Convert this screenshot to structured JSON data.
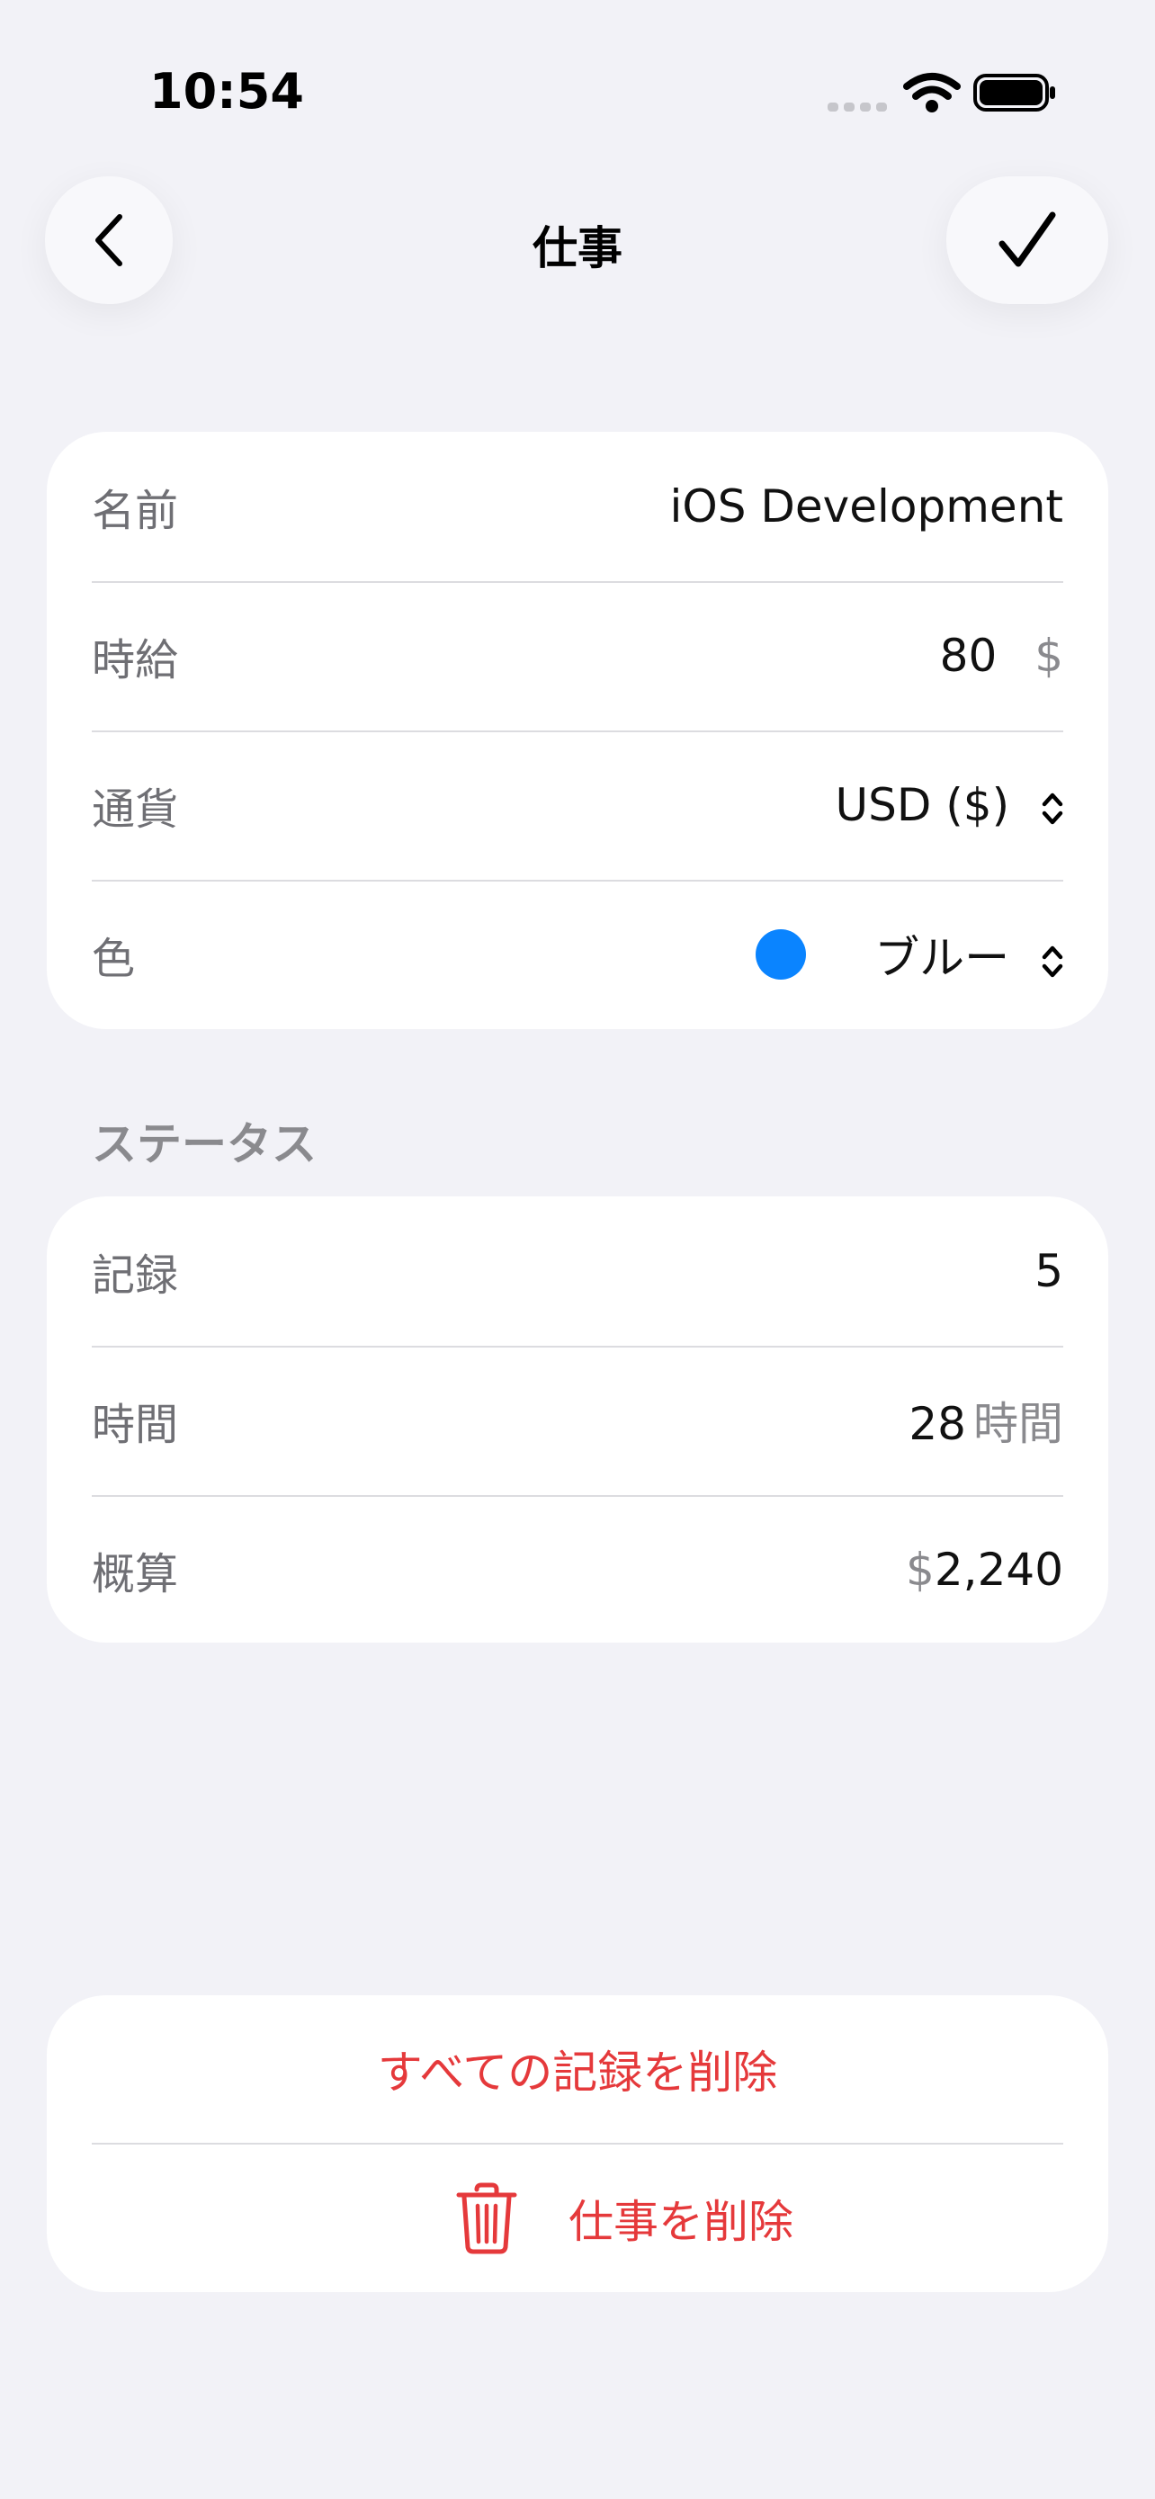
{
  "status_bar": {
    "time": "10:54"
  },
  "nav": {
    "title": "仕事"
  },
  "details": {
    "name": {
      "label": "名前",
      "value": "iOS Development"
    },
    "hourly_rate": {
      "label": "時給",
      "value": "80",
      "unit": "$"
    },
    "currency": {
      "label": "通貨",
      "value": "USD ($)"
    },
    "color": {
      "label": "色",
      "value": "ブルー",
      "swatch": "#0a84ff"
    }
  },
  "status_section": {
    "header": "ステータス",
    "records": {
      "label": "記録",
      "value": "5"
    },
    "hours": {
      "label": "時間",
      "value": "28",
      "unit": "時間"
    },
    "estimate": {
      "label": "概算",
      "prefix": "$",
      "value": "2,240"
    }
  },
  "actions": {
    "delete_all_records": "すべての記録を削除",
    "delete_job": "仕事を削除"
  },
  "colors": {
    "background": "#f2f2f7",
    "danger": "#e5393b",
    "accent": "#0a84ff"
  }
}
